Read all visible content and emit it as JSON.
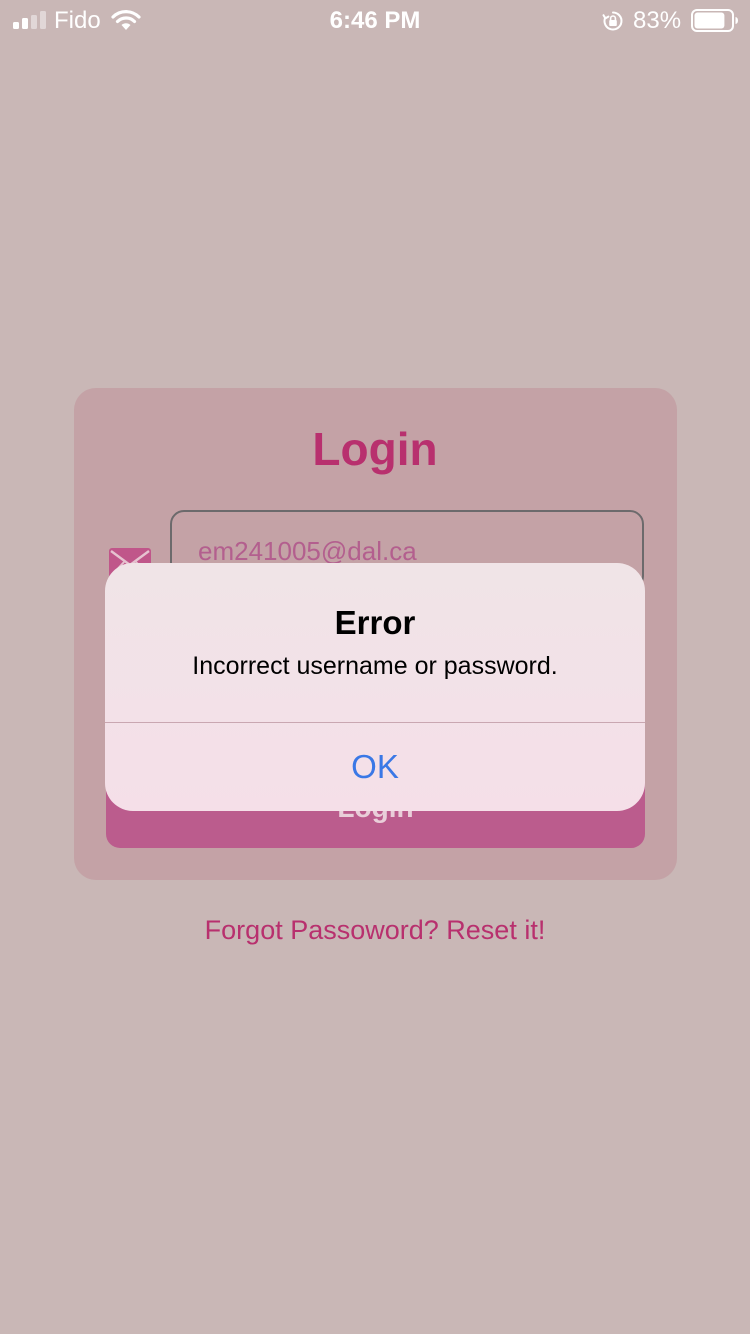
{
  "status_bar": {
    "carrier": "Fido",
    "time": "6:46 PM",
    "battery_percent": "83%",
    "signal_bars_active": 2,
    "signal_bars_total": 4,
    "battery_level": 0.83,
    "icons": [
      "signal-icon",
      "wifi-icon",
      "orientation-lock-icon",
      "battery-icon"
    ]
  },
  "login": {
    "title": "Login",
    "email_value": "em241005@dal.ca",
    "button_label": "Login",
    "forgot_link": "Forgot Passoword? Reset it!",
    "icons": [
      "mail-icon"
    ]
  },
  "alert": {
    "title": "Error",
    "message": "Incorrect username or password.",
    "ok_label": "OK"
  },
  "colors": {
    "background": "#c9b7b6",
    "card": "#c4a2a6",
    "accent": "#b8306e",
    "button": "#bb5c8d",
    "alert_action": "#3a78e6"
  }
}
